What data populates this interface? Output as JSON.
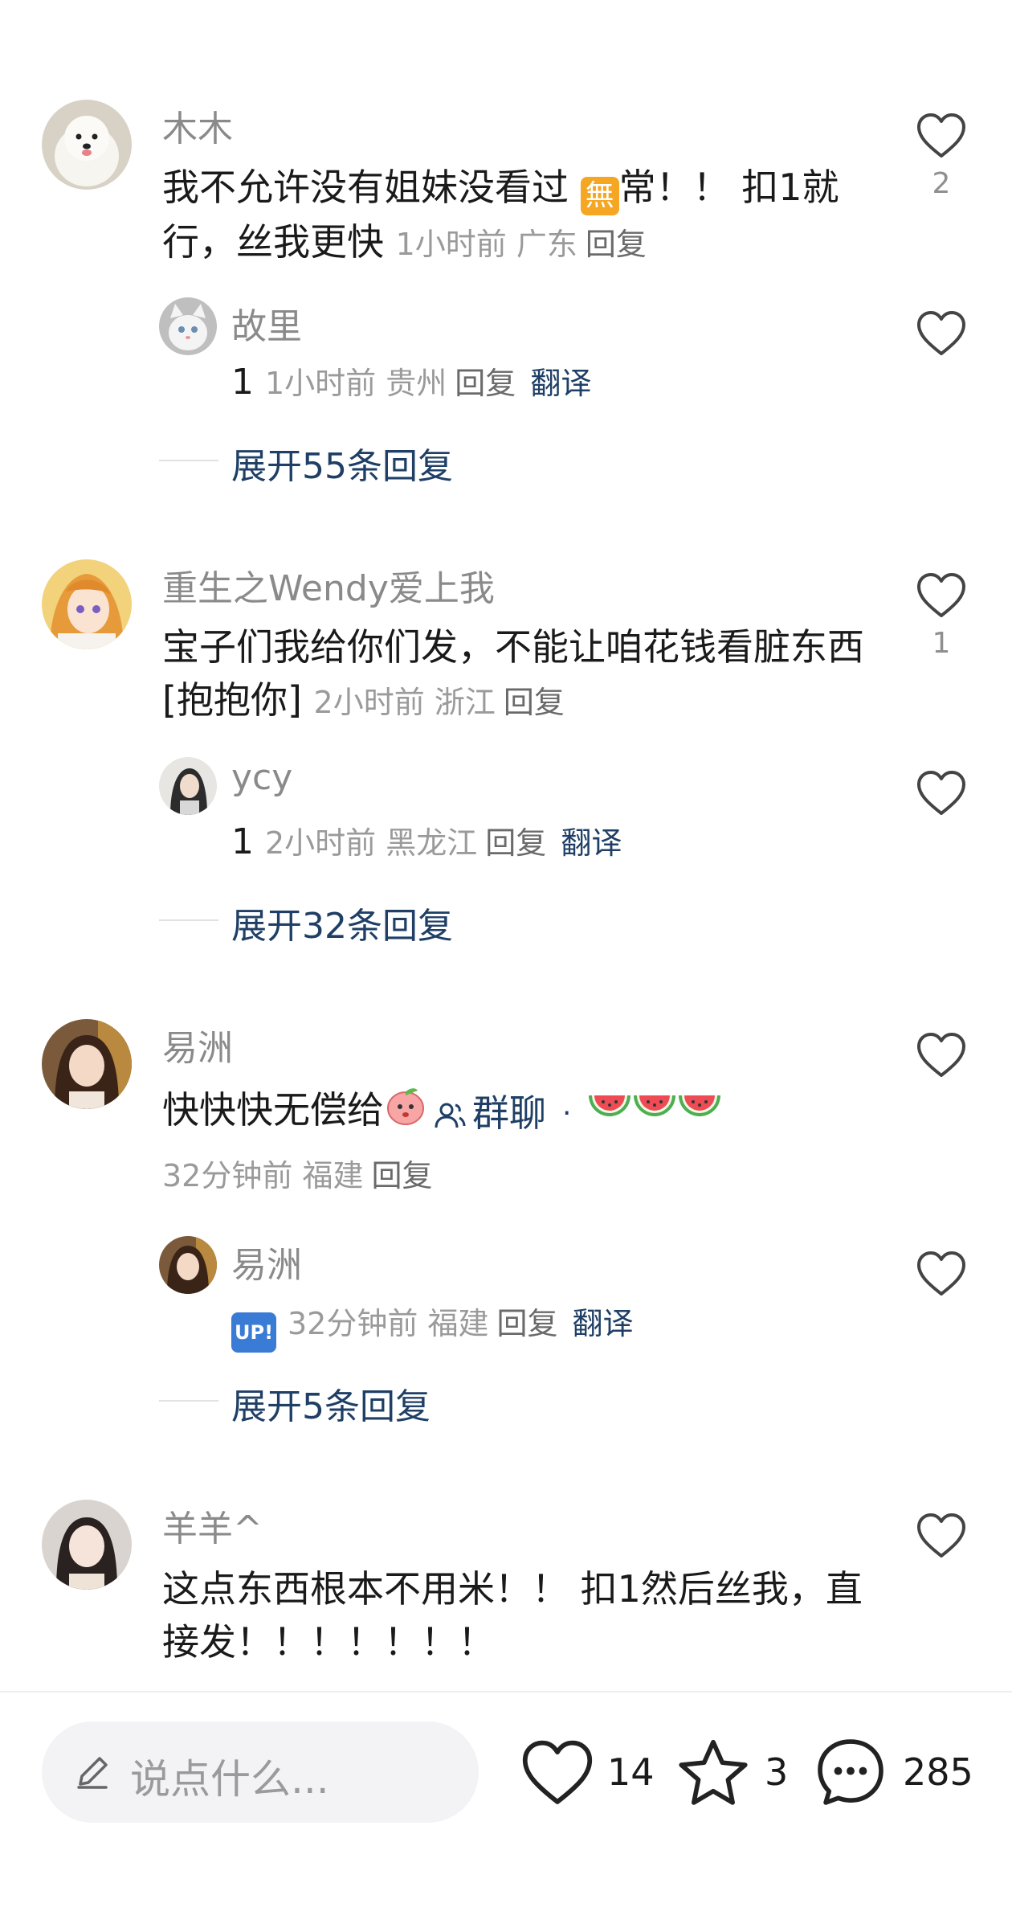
{
  "comments": [
    {
      "username": "木木",
      "text_before_badge": "我不允许没有姐妹没看过 ",
      "badge": "無",
      "text_after_badge": "常！！ 扣1就行，丝我更快",
      "time": "1小时前",
      "location": "广东",
      "reply_label": "回复",
      "likes": "2",
      "reply": {
        "username": "故里",
        "text": "1",
        "time": "1小时前",
        "location": "贵州",
        "reply_label": "回复",
        "translate_label": "翻译"
      },
      "expand_label": "展开55条回复"
    },
    {
      "username": "重生之Wendy爱上我",
      "text": "宝子们我给你们发，不能让咱花钱看脏东西[抱抱你]",
      "time": "2小时前",
      "location": "浙江",
      "reply_label": "回复",
      "likes": "1",
      "reply": {
        "username": "ycy",
        "text": "1",
        "time": "2小时前",
        "location": "黑龙江",
        "reply_label": "回复",
        "translate_label": "翻译"
      },
      "expand_label": "展开32条回复"
    },
    {
      "username": "易洲",
      "text": "快快快无偿给",
      "group_label": "群聊",
      "separator": "·",
      "time": "32分钟前",
      "location": "福建",
      "reply_label": "回复",
      "reply": {
        "username": "易洲",
        "badge": "UP!",
        "time": "32分钟前",
        "location": "福建",
        "reply_label": "回复",
        "translate_label": "翻译"
      },
      "expand_label": "展开5条回复"
    },
    {
      "username": "羊羊^",
      "text": "这点东西根本不用米！！ 扣1然后丝我，直接发！！！！！！！"
    }
  ],
  "bottom_bar": {
    "placeholder": "说点什么...",
    "like_count": "14",
    "star_count": "3",
    "comment_count": "285"
  },
  "colors": {
    "link_blue": "#1f3f66",
    "meta_gray": "#9a9a9a",
    "badge_orange": "#f5a623",
    "badge_blue": "#3a7bd5"
  }
}
